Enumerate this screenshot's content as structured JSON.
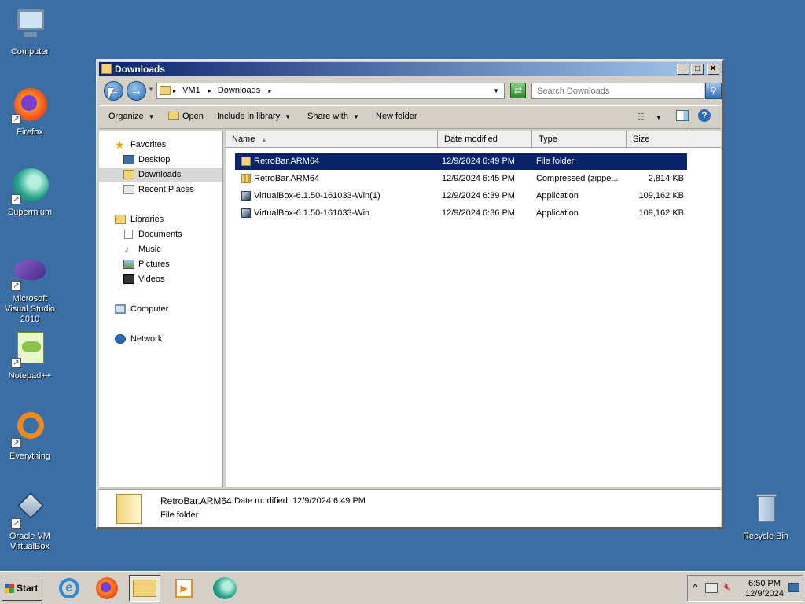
{
  "desktop": {
    "icons": [
      {
        "label": "Computer"
      },
      {
        "label": "Firefox"
      },
      {
        "label": "Supermium"
      },
      {
        "label": "Microsoft Visual Studio 2010"
      },
      {
        "label": "Notepad++"
      },
      {
        "label": "Everything"
      },
      {
        "label": "Oracle VM VirtualBox"
      },
      {
        "label": "Recycle Bin"
      }
    ]
  },
  "window": {
    "title": "Downloads",
    "address": {
      "crumbs": [
        "VM1",
        "Downloads"
      ]
    },
    "search": {
      "placeholder": "Search Downloads"
    },
    "toolbar": {
      "organize": "Organize",
      "open": "Open",
      "include": "Include in library",
      "share": "Share with",
      "new_folder": "New folder"
    },
    "nav": {
      "favorites": "Favorites",
      "desktop": "Desktop",
      "downloads": "Downloads",
      "recent": "Recent Places",
      "libraries": "Libraries",
      "documents": "Documents",
      "music": "Music",
      "pictures": "Pictures",
      "videos": "Videos",
      "computer": "Computer",
      "network": "Network"
    },
    "columns": {
      "name": "Name",
      "date": "Date modified",
      "type": "Type",
      "size": "Size"
    },
    "files": [
      {
        "name": "RetroBar.ARM64",
        "date": "12/9/2024 6:49 PM",
        "type": "File folder",
        "size": "",
        "icon": "folder-icon",
        "selected": true
      },
      {
        "name": "RetroBar.ARM64",
        "date": "12/9/2024 6:45 PM",
        "type": "Compressed (zippe...",
        "size": "2,814 KB",
        "icon": "zip-folder-icon",
        "selected": false
      },
      {
        "name": "VirtualBox-6.1.50-161033-Win(1)",
        "date": "12/9/2024 6:39 PM",
        "type": "Application",
        "size": "109,162 KB",
        "icon": "virtualbox-installer-icon",
        "selected": false
      },
      {
        "name": "VirtualBox-6.1.50-161033-Win",
        "date": "12/9/2024 6:36 PM",
        "type": "Application",
        "size": "109,162 KB",
        "icon": "virtualbox-installer-icon",
        "selected": false
      }
    ],
    "details": {
      "name": "RetroBar.ARM64",
      "date_label": "Date modified:",
      "date": "12/9/2024 6:49 PM",
      "type": "File folder"
    }
  },
  "taskbar": {
    "start": "Start",
    "apps": [
      "internet-explorer-icon",
      "firefox-icon",
      "explorer-icon",
      "media-player-icon",
      "supermium-icon"
    ],
    "clock": {
      "time": "6:50 PM",
      "date": "12/9/2024"
    }
  },
  "colors": {
    "desktop": "#3a6ea5",
    "titlebar_start": "#0a246a",
    "selection": "#0a246a"
  }
}
